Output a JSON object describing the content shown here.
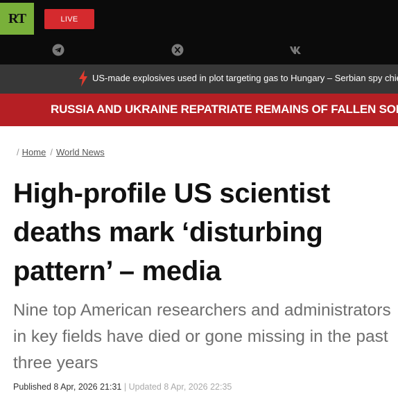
{
  "header": {
    "logo_text": "RT",
    "live_label": "LIVE",
    "social": [
      {
        "icon": "telegram-icon"
      },
      {
        "icon": "x-icon"
      },
      {
        "icon": "vk-icon"
      }
    ]
  },
  "ticker": {
    "icon": "lightning-icon",
    "text": "US-made explosives used in plot targeting gas to Hungary – Serbian spy chief"
  },
  "breaking": {
    "text": "RUSSIA AND UKRAINE REPATRIATE REMAINS OF FALLEN SOLDIERS"
  },
  "breadcrumb": {
    "items": [
      "Home",
      "World News"
    ]
  },
  "article": {
    "title": "High-profile US scientist deaths mark ‘disturbing pattern’ – media",
    "summary": "Nine top American researchers and administrators in key fields have died or gone missing in the past three years",
    "published": "Published 8 Apr, 2026 21:31",
    "updated": "Updated 8 Apr, 2026 22:35"
  },
  "colors": {
    "logo_green": "#79b03a",
    "live_red": "#d52a2e",
    "ticker_gray": "#373737",
    "breaking_red": "#b51f24",
    "header_black": "#0b0b0b"
  }
}
